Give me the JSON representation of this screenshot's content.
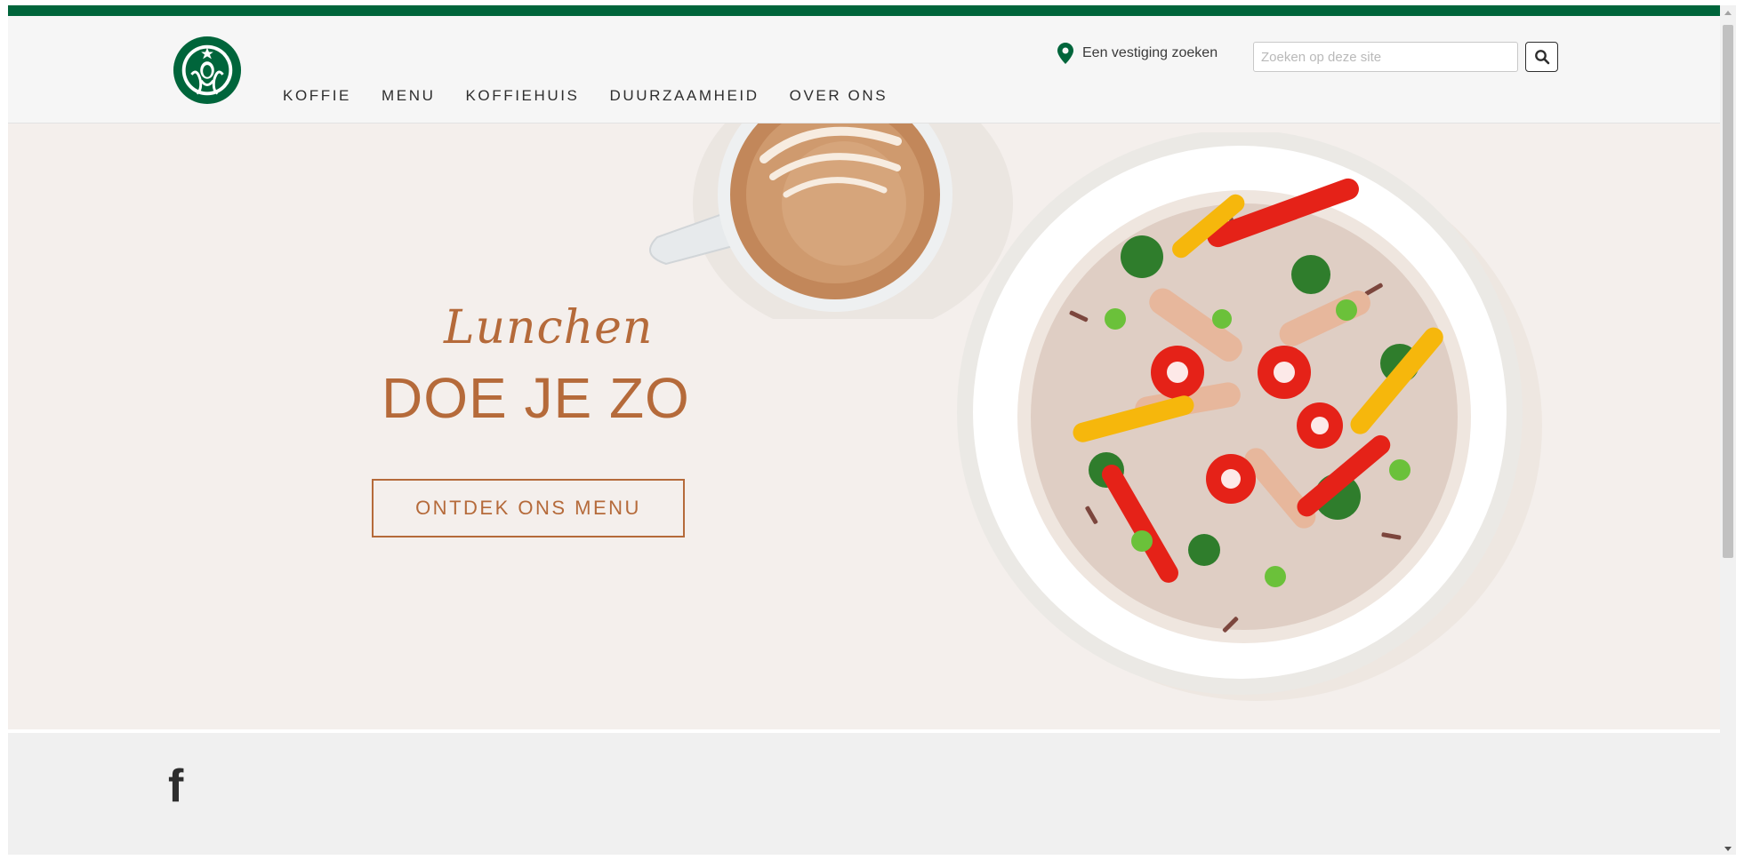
{
  "brand": {
    "color": "#00653b",
    "logo_icon": "siren-logo-icon"
  },
  "nav": {
    "items": [
      {
        "label": "KOFFIE"
      },
      {
        "label": "MENU"
      },
      {
        "label": "KOFFIEHUIS"
      },
      {
        "label": "DUURZAAMHEID"
      },
      {
        "label": "OVER ONS"
      }
    ]
  },
  "header": {
    "store_locator_label": "Een vestiging zoeken",
    "locator_icon": "map-pin-icon",
    "search": {
      "placeholder": "Zoeken op deze site",
      "value": "",
      "icon": "search-icon"
    }
  },
  "hero": {
    "tagline": "Lunchen",
    "headline": "DOE JE ZO",
    "cta_label": "ONTDEK ONS MENU",
    "accent_color": "#b56a3a"
  },
  "footer": {
    "social_icon": "facebook-icon",
    "social_glyph": "f"
  }
}
